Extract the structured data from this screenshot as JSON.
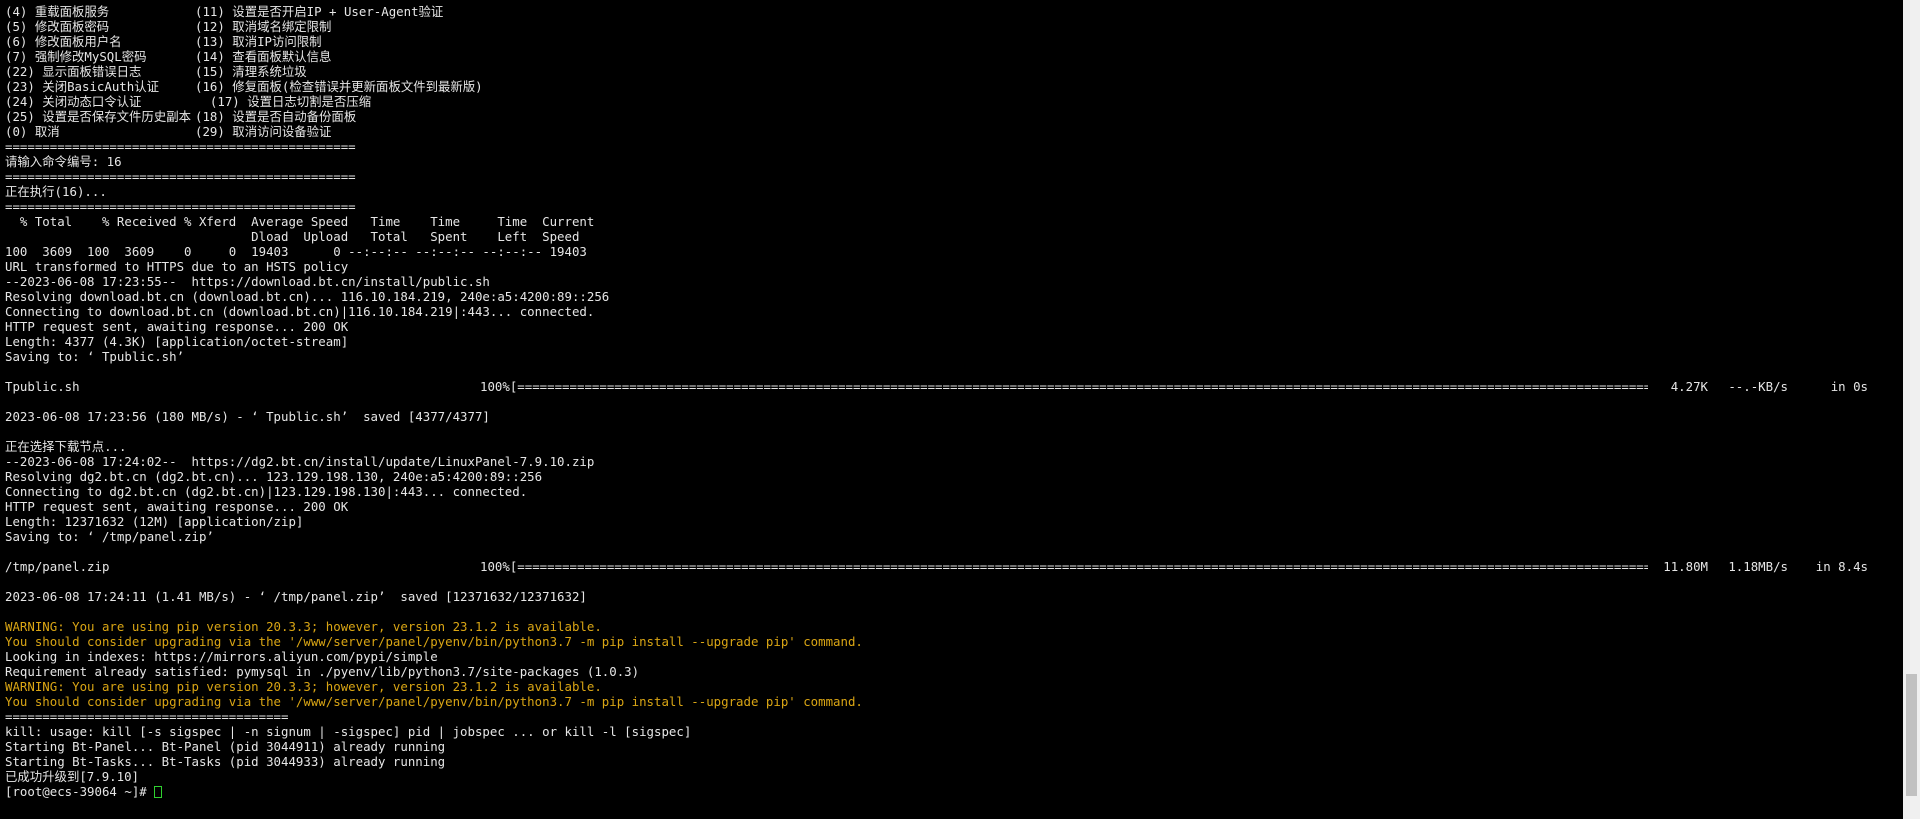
{
  "menu": [
    [
      "(4) 重载面板服务",
      "(11) 设置是否开启IP + User-Agent验证"
    ],
    [
      "(5) 修改面板密码",
      "(12) 取消域名绑定限制"
    ],
    [
      "(6) 修改面板用户名",
      "(13) 取消IP访问限制"
    ],
    [
      "(7) 强制修改MySQL密码",
      "(14) 查看面板默认信息"
    ],
    [
      "(22) 显示面板错误日志",
      "(15) 清理系统垃圾"
    ],
    [
      "(23) 关闭BasicAuth认证",
      "(16) 修复面板(检查错误并更新面板文件到最新版)"
    ],
    [
      "(24) 关闭动态口令认证",
      "  (17) 设置日志切割是否压缩"
    ],
    [
      "(25) 设置是否保存文件历史副本",
      "(18) 设置是否自动备份面板"
    ],
    [
      "(0) 取消",
      "(29) 取消访问设备验证"
    ]
  ],
  "lines_a": [
    "===============================================",
    "请输入命令编号: 16",
    "===============================================",
    "正在执行(16)...",
    "===============================================",
    "  % Total    % Received % Xferd  Average Speed   Time    Time     Time  Current",
    "                                 Dload  Upload   Total   Spent    Left  Speed",
    "100  3609  100  3609    0     0  19403      0 --:--:-- --:--:-- --:--:-- 19403",
    "URL transformed to HTTPS due to an HSTS policy",
    "--2023-06-08 17:23:55--  https://download.bt.cn/install/public.sh",
    "Resolving download.bt.cn (download.bt.cn)... 116.10.184.219, 240e:a5:4200:89::256",
    "Connecting to download.bt.cn (download.bt.cn)|116.10.184.219|:443... connected.",
    "HTTP request sent, awaiting response... 200 OK",
    "Length: 4377 (4.3K) [application/octet-stream]",
    "Saving to: ‘ Tpublic.sh’",
    ""
  ],
  "progress1": {
    "name": "Tpublic.sh",
    "percent": "100%",
    "bar": "[===============================================================================================================================================================================================>]",
    "size": "4.27K",
    "speed": "--.-KB/s",
    "time": "in 0s"
  },
  "lines_b": [
    "",
    "2023-06-08 17:23:56 (180 MB/s) - ‘ Tpublic.sh’  saved [4377/4377]",
    "",
    "正在选择下载节点...",
    "--2023-06-08 17:24:02--  https://dg2.bt.cn/install/update/LinuxPanel-7.9.10.zip",
    "Resolving dg2.bt.cn (dg2.bt.cn)... 123.129.198.130, 240e:a5:4200:89::256",
    "Connecting to dg2.bt.cn (dg2.bt.cn)|123.129.198.130|:443... connected.",
    "HTTP request sent, awaiting response... 200 OK",
    "Length: 12371632 (12M) [application/zip]",
    "Saving to: ‘ /tmp/panel.zip’",
    ""
  ],
  "progress2": {
    "name": "/tmp/panel.zip",
    "percent": "100%",
    "bar": "[===============================================================================================================================================================================================>]",
    "size": "11.80M",
    "speed": "1.18MB/s",
    "time": "in 8.4s"
  },
  "lines_c": [
    {
      "text": "",
      "warn": false
    },
    {
      "text": "2023-06-08 17:24:11 (1.41 MB/s) - ‘ /tmp/panel.zip’  saved [12371632/12371632]",
      "warn": false
    },
    {
      "text": "",
      "warn": false
    },
    {
      "text": "WARNING: You are using pip version 20.3.3; however, version 23.1.2 is available.",
      "warn": true
    },
    {
      "text": "You should consider upgrading via the '/www/server/panel/pyenv/bin/python3.7 -m pip install --upgrade pip' command.",
      "warn": true
    },
    {
      "text": "Looking in indexes: https://mirrors.aliyun.com/pypi/simple",
      "warn": false
    },
    {
      "text": "Requirement already satisfied: pymysql in ./pyenv/lib/python3.7/site-packages (1.0.3)",
      "warn": false
    },
    {
      "text": "WARNING: You are using pip version 20.3.3; however, version 23.1.2 is available.",
      "warn": true
    },
    {
      "text": "You should consider upgrading via the '/www/server/panel/pyenv/bin/python3.7 -m pip install --upgrade pip' command.",
      "warn": true
    },
    {
      "text": "======================================",
      "warn": false
    },
    {
      "text": "kill: usage: kill [-s sigspec | -n signum | -sigspec] pid | jobspec ... or kill -l [sigspec]",
      "warn": false
    },
    {
      "text": "Starting Bt-Panel... Bt-Panel (pid 3044911) already running",
      "warn": false
    },
    {
      "text": "Starting Bt-Tasks... Bt-Tasks (pid 3044933) already running",
      "warn": false
    },
    {
      "text": "已成功升级到[7.9.10]",
      "warn": false
    }
  ],
  "prompt": "[root@ecs-39064 ~]# ",
  "scrollbar": {
    "position": 0.97,
    "visible_fraction": 0.15
  },
  "colors": {
    "background": "#000000",
    "text": "#e6e6e6",
    "warning": "#d9a514",
    "cursor": "#2fd12f"
  }
}
